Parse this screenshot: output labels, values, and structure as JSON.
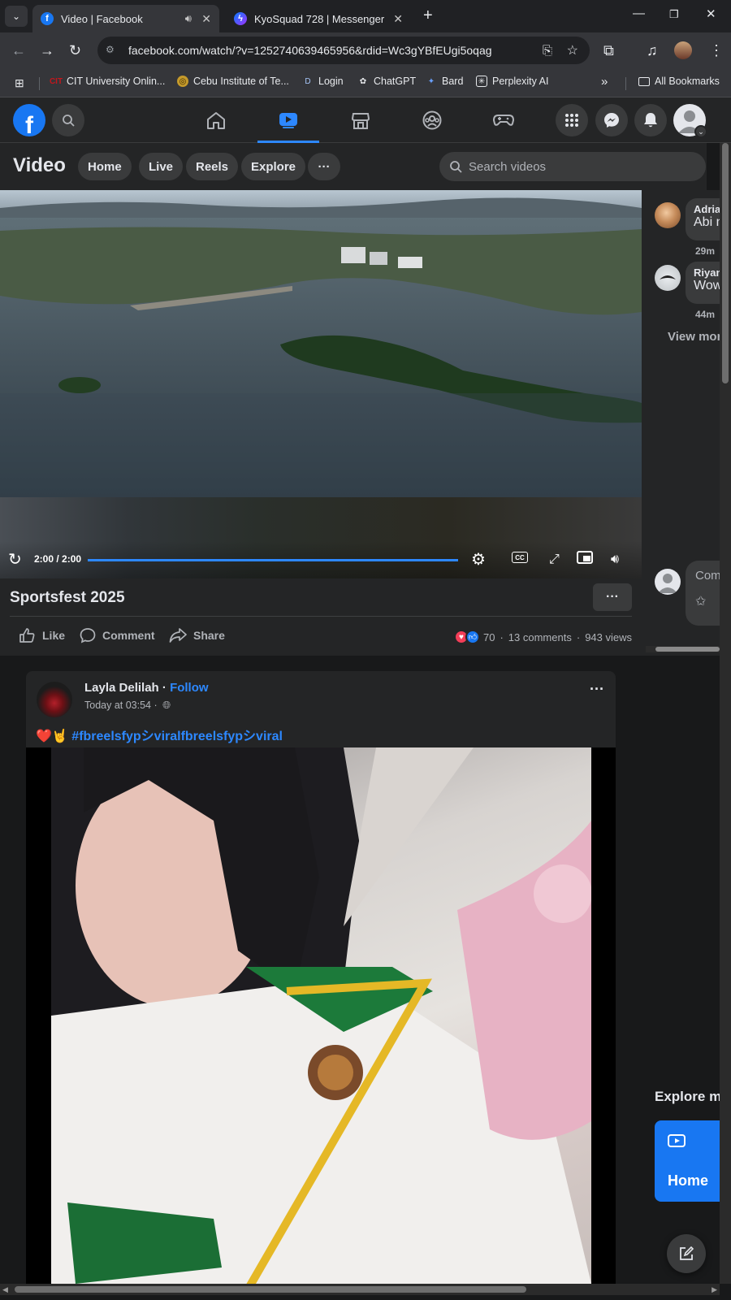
{
  "browser": {
    "tabs": [
      {
        "title": "Video | Facebook",
        "active": true,
        "audio": true
      },
      {
        "title": "KyoSquad 728 | Messenger",
        "active": false
      }
    ],
    "new_tab": "+",
    "url": "facebook.com/watch/?v=1252740639465956&rdid=Wc3gYBfEUgi5oqag",
    "bookmarks": [
      {
        "label": "CIT University Onlin...",
        "icon": "cit-icon"
      },
      {
        "label": "Cebu Institute of Te...",
        "icon": "cebu-icon"
      },
      {
        "label": "Login",
        "icon": "login-icon"
      },
      {
        "label": "ChatGPT",
        "icon": "chatgpt-icon"
      },
      {
        "label": "Bard",
        "icon": "bard-icon"
      },
      {
        "label": "Perplexity AI",
        "icon": "perplexity-icon"
      }
    ],
    "bookmarks_overflow": "»",
    "all_bookmarks": "All Bookmarks"
  },
  "fb": {
    "logo": "f",
    "nav_tabs": [
      "home-icon",
      "video-icon",
      "marketplace-icon",
      "groups-icon",
      "gaming-icon"
    ],
    "active_tab": 1
  },
  "video_header": {
    "title": "Video",
    "pills": [
      "Home",
      "Live",
      "Reels",
      "Explore"
    ],
    "more": "···",
    "search_placeholder": "Search videos"
  },
  "player": {
    "time": "2:00 / 2:00",
    "progress": 1.0
  },
  "info": {
    "title": "Sportsfest 2025",
    "more": "···",
    "actions": [
      "Like",
      "Comment",
      "Share"
    ],
    "reaction_count": "70",
    "comments": "13 comments",
    "views": "943 views"
  },
  "comments_panel": {
    "items": [
      {
        "name": "Adria",
        "text": "Abi n",
        "time": "29m"
      },
      {
        "name": "Riyan",
        "text": "Wow",
        "time": "44m"
      }
    ],
    "view_more": "View mor",
    "comment_placeholder": "Comm"
  },
  "post": {
    "author": "Layla Delilah",
    "separator": " · ",
    "follow": "Follow",
    "time": "Today at 03:54 ·",
    "caption_emoji": "❤️🤘",
    "caption": "#fbreelsfypシviralfbreelsfypシviral",
    "more": "···"
  },
  "explore": {
    "title": "Explore mo",
    "card_label": "Home"
  },
  "colors": {
    "accent": "#2d88ff",
    "fb_blue": "#1877f2",
    "bg": "#18191a",
    "surface": "#242526"
  }
}
